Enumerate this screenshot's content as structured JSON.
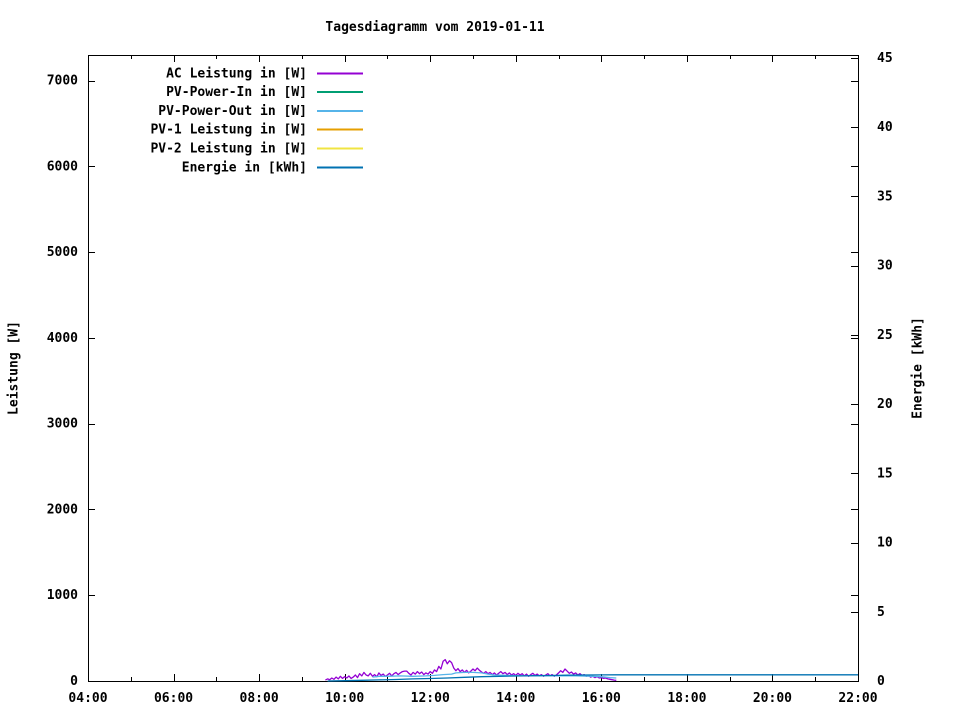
{
  "chart_data": {
    "type": "line",
    "title": "Tagesdiagramm vom 2019-01-11",
    "ylabel": "Leistung [W]",
    "y2label": "Energie [kWh]",
    "x_range_hours": [
      4,
      22
    ],
    "y_range": [
      0,
      7300
    ],
    "y2_range": [
      0,
      45.2
    ],
    "grid": false,
    "legend_position": "top-left-inside",
    "x_ticks": [
      {
        "hour": 4,
        "label": "04:00"
      },
      {
        "hour": 6,
        "label": "06:00"
      },
      {
        "hour": 8,
        "label": "08:00"
      },
      {
        "hour": 10,
        "label": "10:00"
      },
      {
        "hour": 12,
        "label": "12:00"
      },
      {
        "hour": 14,
        "label": "14:00"
      },
      {
        "hour": 16,
        "label": "16:00"
      },
      {
        "hour": 18,
        "label": "18:00"
      },
      {
        "hour": 20,
        "label": "20:00"
      },
      {
        "hour": 22,
        "label": "22:00"
      }
    ],
    "x_minor_tick_hours": [
      5,
      7,
      9,
      11,
      13,
      15,
      17,
      19,
      21
    ],
    "y_ticks": [
      {
        "value": 0,
        "label": "0"
      },
      {
        "value": 1000,
        "label": "1000"
      },
      {
        "value": 2000,
        "label": "2000"
      },
      {
        "value": 3000,
        "label": "3000"
      },
      {
        "value": 4000,
        "label": "4000"
      },
      {
        "value": 5000,
        "label": "5000"
      },
      {
        "value": 6000,
        "label": "6000"
      },
      {
        "value": 7000,
        "label": "7000"
      }
    ],
    "y2_ticks": [
      {
        "value": 0,
        "label": "0"
      },
      {
        "value": 5,
        "label": "5"
      },
      {
        "value": 10,
        "label": "10"
      },
      {
        "value": 15,
        "label": "15"
      },
      {
        "value": 20,
        "label": "20"
      },
      {
        "value": 25,
        "label": "25"
      },
      {
        "value": 30,
        "label": "30"
      },
      {
        "value": 35,
        "label": "35"
      },
      {
        "value": 40,
        "label": "40"
      },
      {
        "value": 45,
        "label": "45"
      }
    ],
    "series": [
      {
        "name": "AC Leistung in [W]",
        "color": "#9400d3",
        "axis": "y1",
        "t0": 9.55,
        "dt": 0.05,
        "values": [
          10,
          25,
          15,
          35,
          20,
          45,
          25,
          55,
          30,
          50,
          35,
          60,
          30,
          45,
          70,
          40,
          85,
          60,
          100,
          70,
          60,
          90,
          55,
          75,
          50,
          95,
          65,
          80,
          55,
          70,
          90,
          60,
          85,
          100,
          75,
          95,
          110,
          115,
          115,
          90,
          70,
          100,
          80,
          110,
          85,
          105,
          75,
          95,
          80,
          110,
          90,
          130,
          110,
          170,
          140,
          230,
          250,
          200,
          235,
          215,
          150,
          120,
          145,
          110,
          130,
          100,
          125,
          95,
          115,
          140,
          120,
          150,
          125,
          105,
          90,
          110,
          85,
          100,
          75,
          95,
          70,
          90,
          110,
          85,
          100,
          75,
          95,
          70,
          85,
          65,
          90,
          70,
          85,
          60,
          80,
          55,
          75,
          90,
          65,
          80,
          60,
          75,
          55,
          70,
          85,
          60,
          75,
          55,
          70,
          95,
          120,
          100,
          140,
          115,
          90,
          105,
          80,
          95,
          70,
          85,
          65,
          75,
          55,
          65,
          45,
          55,
          40,
          50,
          35,
          40,
          30,
          35,
          25,
          20,
          15,
          10,
          8
        ]
      },
      {
        "name": "PV-Power-In in [W]",
        "color": "#009e73",
        "axis": "y1",
        "points": []
      },
      {
        "name": "PV-Power-Out in [W]",
        "color": "#56b4e9",
        "axis": "y1",
        "points": [
          [
            10.65,
            45
          ],
          [
            10.8,
            55
          ],
          [
            11.0,
            55
          ],
          [
            11.3,
            60
          ],
          [
            11.6,
            55
          ],
          [
            11.9,
            60
          ],
          [
            12.1,
            65
          ],
          [
            12.3,
            75
          ],
          [
            12.5,
            80
          ],
          [
            12.6,
            95
          ],
          [
            12.8,
            100
          ],
          [
            13.0,
            100
          ],
          [
            13.2,
            95
          ],
          [
            13.35,
            80
          ],
          [
            13.5,
            70
          ],
          [
            13.8,
            65
          ],
          [
            14.2,
            60
          ],
          [
            14.6,
            60
          ],
          [
            15.0,
            62
          ],
          [
            15.4,
            60
          ],
          [
            15.8,
            55
          ],
          [
            16.0,
            50
          ],
          [
            16.2,
            40
          ],
          [
            16.35,
            35
          ]
        ]
      },
      {
        "name": "PV-1 Leistung in [W]",
        "color": "#e69f00",
        "axis": "y1",
        "points": []
      },
      {
        "name": "PV-2 Leistung in [W]",
        "color": "#f0e442",
        "axis": "y1",
        "points": []
      },
      {
        "name": "Energie in [kWh]",
        "color": "#0072b2",
        "axis": "y2",
        "points": [
          [
            9.6,
            0
          ],
          [
            10.0,
            0.02
          ],
          [
            10.4,
            0.05
          ],
          [
            10.8,
            0.08
          ],
          [
            11.2,
            0.11
          ],
          [
            11.6,
            0.15
          ],
          [
            12.0,
            0.18
          ],
          [
            12.4,
            0.22
          ],
          [
            12.8,
            0.27
          ],
          [
            13.2,
            0.31
          ],
          [
            13.6,
            0.34
          ],
          [
            14.0,
            0.36
          ],
          [
            14.4,
            0.38
          ],
          [
            14.8,
            0.4
          ],
          [
            15.2,
            0.42
          ],
          [
            15.6,
            0.43
          ],
          [
            16.0,
            0.44
          ],
          [
            16.35,
            0.45
          ],
          [
            18.0,
            0.45
          ],
          [
            20.0,
            0.45
          ],
          [
            22.0,
            0.45
          ]
        ]
      }
    ]
  }
}
